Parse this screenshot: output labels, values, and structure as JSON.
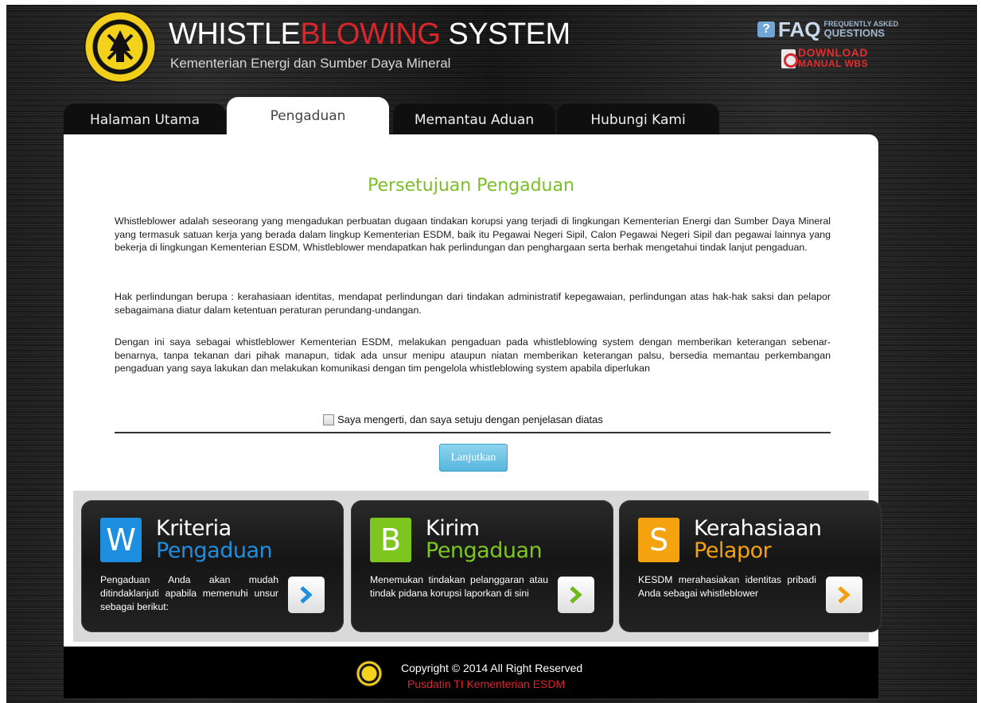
{
  "header": {
    "title_part1": "WHISTLE",
    "title_part2": "BLOWING",
    "title_part3": " SYSTEM",
    "subtitle": "Kementerian Energi dan Sumber Daya Mineral",
    "faq_label": "FAQ",
    "faq_small_1": "FREQUENTLY ASKED",
    "faq_small_2": "QUESTIONS",
    "download_line1": "DOWNLOAD",
    "download_line2": "MANUAL WBS"
  },
  "tabs": [
    {
      "label": "Halaman Utama",
      "active": false
    },
    {
      "label": "Pengaduan",
      "active": true
    },
    {
      "label": "Memantau Aduan",
      "active": false
    },
    {
      "label": "Hubungi Kami",
      "active": false
    }
  ],
  "main": {
    "heading": "Persetujuan Pengaduan",
    "paragraph1": "Whistleblower adalah seseorang yang mengadukan perbuatan dugaan tindakan korupsi yang terjadi di lingkungan Kementerian Energi dan Sumber Daya Mineral yang termasuk satuan kerja yang berada dalam lingkup Kementerian ESDM, baik itu Pegawai Negeri Sipil, Calon Pegawai Negeri Sipil dan pegawai lainnya yang bekerja di lingkungan Kementerian ESDM, Whistleblower mendapatkan hak perlindungan dan penghargaan serta berhak mengetahui tindak lanjut pengaduan.",
    "paragraph2": "Hak perlindungan berupa : kerahasiaan identitas, mendapat perlindungan dari tindakan administratif kepegawaian, perlindungan atas hak-hak saksi dan pelapor sebagaimana diatur dalam ketentuan peraturan perundang-undangan.",
    "paragraph3": "Dengan ini saya sebagai whistleblower Kementerian ESDM, melakukan pengaduan pada whistleblowing system dengan memberikan keterangan sebenar-benarnya, tanpa tekanan dari pihak manapun, tidak ada unsur menipu ataupun niatan memberikan keterangan palsu, bersedia memantau perkembangan pengaduan yang saya lakukan dan melakukan komunikasi dengan tim pengelola whistleblowing system apabila diperlukan",
    "agree_label": "Saya mengerti, dan saya setuju dengan penjelasan diatas",
    "agree_checked": false,
    "next_button": "Lanjutkan"
  },
  "cards": [
    {
      "letter": "W",
      "title1": "Kriteria",
      "title2": "Pengaduan",
      "description": "Pengaduan Anda akan mudah ditindaklanjuti apabila memenuhi unsur sebagai berikut:",
      "color": "#1e8fe0",
      "arrow_color": "#1e8fe0"
    },
    {
      "letter": "B",
      "title1": "Kirim",
      "title2": "Pengaduan",
      "description": "Menemukan tindakan pelanggaran atau tindak pidana korupsi laporkan di sini",
      "color": "#7ec520",
      "arrow_color": "#6fb81b"
    },
    {
      "letter": "S",
      "title1": "Kerahasiaan",
      "title2": "Pelapor",
      "description": "KESDM merahasiakan identitas pribadi Anda sebagai whistleblower",
      "color": "#f5a20f",
      "arrow_color": "#f0a012"
    }
  ],
  "footer": {
    "copyright": "Copyright © 2014 All Right Reserved",
    "org": "Pusdatin TI Kementerian ESDM"
  },
  "colors": {
    "heading_green": "#7bbf26",
    "brand_red": "#d9262b",
    "button_blue": "#55b6de"
  }
}
